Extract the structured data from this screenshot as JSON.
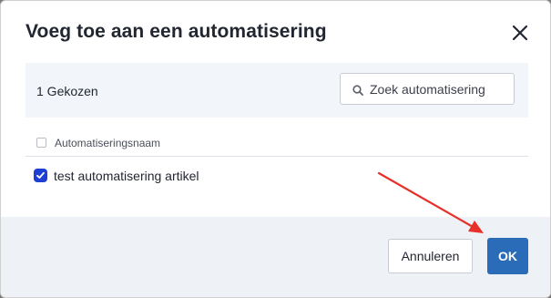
{
  "dialog": {
    "title": "Voeg toe aan een automatisering",
    "close_icon": "close-icon"
  },
  "toolbar": {
    "selected_count": "1 Gekozen",
    "search": {
      "placeholder": "Zoek automatisering",
      "value": "",
      "icon": "search-icon"
    }
  },
  "table": {
    "columns": [
      "Automatiseringsnaam"
    ],
    "header_checked": false,
    "rows": [
      {
        "name": "test automatisering artikel",
        "checked": true
      }
    ]
  },
  "footer": {
    "cancel_label": "Annuleren",
    "ok_label": "OK"
  },
  "colors": {
    "accent": "#2b6cb8",
    "checkbox": "#1d3fd4",
    "annotation_arrow": "#e8302a",
    "toolbar_bg": "#f2f5fa",
    "footer_bg": "#eef1f6"
  }
}
